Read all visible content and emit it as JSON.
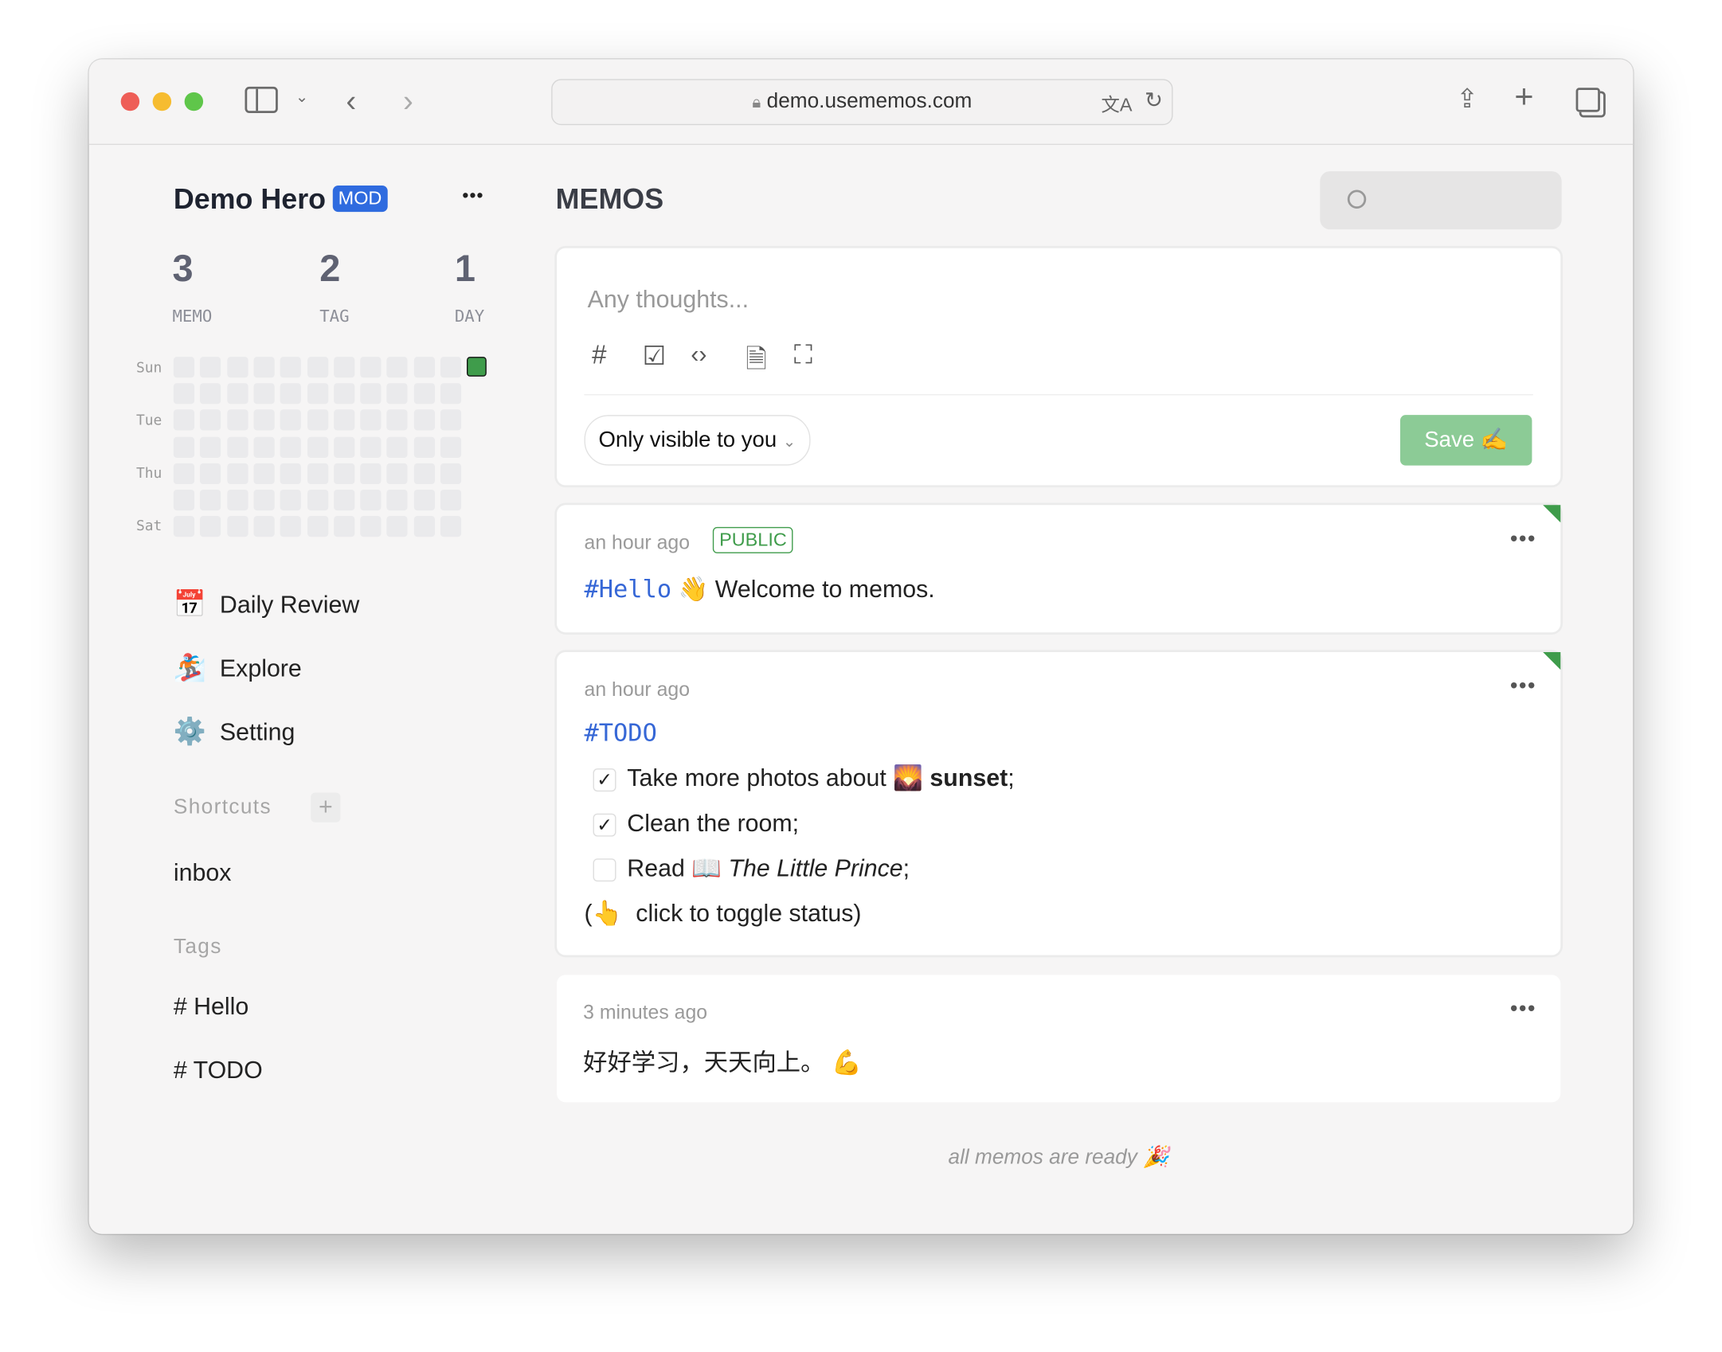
{
  "browser": {
    "url": "demo.usememos.com"
  },
  "sidebar": {
    "user_name": "Demo Hero",
    "role_badge": "MOD",
    "more": "•••",
    "stats": [
      {
        "value": "3",
        "label": "MEMO"
      },
      {
        "value": "2",
        "label": "TAG"
      },
      {
        "value": "1",
        "label": "DAY"
      }
    ],
    "heatmap": {
      "day_labels": [
        "Sun",
        "Tue",
        "Thu",
        "Sat"
      ],
      "weeks": 12,
      "active_color": "#3f9c4b",
      "active_cells": [
        {
          "week": 12,
          "day": "Sun",
          "count": 1
        }
      ]
    },
    "nav": [
      {
        "icon": "calendar-icon",
        "glyph": "📅",
        "label": "Daily Review"
      },
      {
        "icon": "explore-icon",
        "glyph": "🏂",
        "label": "Explore"
      },
      {
        "icon": "gear-icon",
        "glyph": "⚙️",
        "label": "Setting"
      }
    ],
    "shortcuts_title": "Shortcuts",
    "shortcuts_add": "+",
    "shortcuts": [
      "inbox"
    ],
    "tags_title": "Tags",
    "tags": [
      "# Hello",
      "# TODO"
    ]
  },
  "main": {
    "title": "MEMOS",
    "editor": {
      "placeholder": "Any thoughts...",
      "visibility": "Only visible to you",
      "save_label": "Save",
      "save_emoji": "✍️"
    },
    "memos": [
      {
        "time": "an hour ago",
        "badge": "PUBLIC",
        "tag": "#Hello",
        "emoji": "👋",
        "text": "Welcome to memos."
      },
      {
        "time": "an hour ago",
        "tag": "#TODO",
        "items": [
          {
            "checked": true,
            "text": "Take more photos about",
            "emoji": "🌄",
            "bold": "sunset",
            "after": ";"
          },
          {
            "checked": true,
            "text": "Clean the room;"
          },
          {
            "checked": false,
            "text": "Read",
            "emoji": "📖",
            "italic": "The Little Prince",
            "after": ";"
          }
        ],
        "note_open": "(",
        "note_emoji": "👆",
        "note": "click to toggle status)"
      },
      {
        "time": "3 minutes ago",
        "text": "好好学习，天天向上。",
        "emoji": "💪"
      }
    ],
    "footer": "all memos are ready",
    "footer_emoji": "🎉"
  },
  "colors": {
    "accent": "#3667d6",
    "green": "#3f9c4b",
    "save_bg": "#8ccb96"
  }
}
